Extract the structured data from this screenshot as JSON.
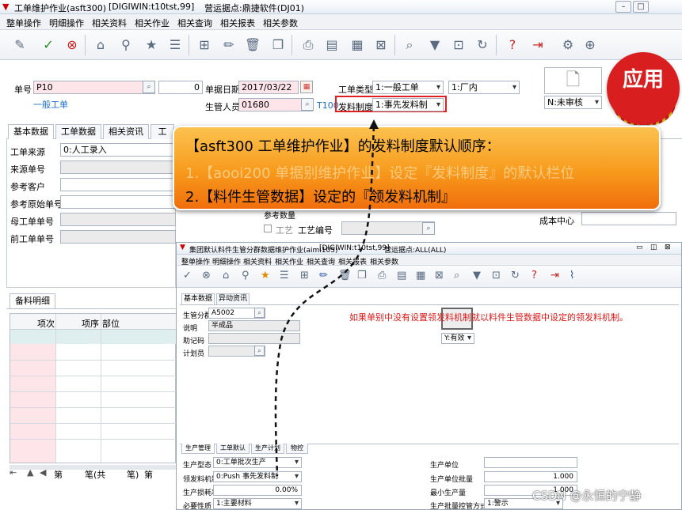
{
  "window": {
    "title": "工单维护作业(asft300)",
    "server": "[DIGIWIN:t10tst,99]",
    "site": "营运据点:鼎捷软件(DJ01)"
  },
  "menu": [
    "整单操作",
    "明细操作",
    "相关资料",
    "相关作业",
    "相关查询",
    "相关报表",
    "相关参数"
  ],
  "header": {
    "doc_no_label": "单号",
    "doc_no": "P10",
    "zero_value": "0",
    "doc_type_desc": "一般工单",
    "date_label": "单据日期",
    "date_value": "2017/03/22",
    "mgr_label": "生管人员",
    "mgr_value": "01680",
    "t_code": "T100",
    "wo_type_label": "工单类型",
    "wo_type_value": "1:一般工单",
    "factory_value": "1:厂内",
    "issue_label": "发料制度",
    "issue_value": "1:事先发料制",
    "status_value": "N:未审核"
  },
  "badge": {
    "text": "应用"
  },
  "main_tabs": [
    "基本数据",
    "工单数据",
    "相关资讯",
    "工"
  ],
  "form": {
    "source_label": "工单来源",
    "source_value": "0:人工录入",
    "src_no_label": "来源单号",
    "cust_label": "参考客户",
    "orig_label": "参考原始单号",
    "parent_label": "母工单单号",
    "prev_label": "前工单单号",
    "ref_qty_label": "参考数量",
    "proc_label": "工艺",
    "proc_no_label": "工艺编号",
    "cost_center_label": "成本中心"
  },
  "detail": {
    "tab": "备料明细",
    "col_seq": "项次",
    "col_item": "项序",
    "col_dept": "部位",
    "nav": [
      "第",
      "笔(共",
      "笔)",
      "第"
    ]
  },
  "callout": {
    "line1": "【asft300 工单维护作业】的发料制度默认顺序：",
    "line2": "1.【aooi200 单据别维护作业】设定『发料制度』的默认栏位",
    "line3": "2.【料件生管数据】设定的『领发料机制』"
  },
  "inset": {
    "title": "集团默认料件生管分群数据维护作业(aimi105)",
    "server": "[DIGIWIN:t10tst,99]",
    "site": "营运据点:ALL(ALL)",
    "menu": [
      "整单操作",
      "明细操作",
      "相关资料",
      "相关作业",
      "相关查询",
      "相关报表",
      "相关参数"
    ],
    "tabs": [
      "基本数据",
      "异动资讯"
    ],
    "group_label": "生管分群",
    "group_value": "A5002",
    "desc_label": "说明",
    "desc_value": "半成品",
    "memo_label": "助记码",
    "planner_label": "计划员",
    "valid_value": "Y:有效",
    "note": "如果单别中没有设置领发料机制就以料件生管数据中设定的领发料机制。",
    "bottom_tabs": [
      "生产管理",
      "工单默认",
      "生产计划",
      "物控"
    ],
    "prod_type_label": "生产型态",
    "prod_type_value": "0:工单批次生产",
    "issue_mech_label": "领发料机制",
    "issue_mech_value": "0:Push 事先发料制",
    "loss_label": "生产损耗率",
    "loss_value": "0.00%",
    "nature_label": "必要性质",
    "nature_value": "1:主要材料",
    "unit_label": "生产单位",
    "batch_label": "生产单位批量",
    "batch_value": "1.000",
    "min_label": "最小生产量",
    "min_value": "1.000",
    "ctrl_label": "生产批量控管方式",
    "ctrl_value": "1:警示"
  },
  "watermark": "CSDN @永恒的宁静"
}
